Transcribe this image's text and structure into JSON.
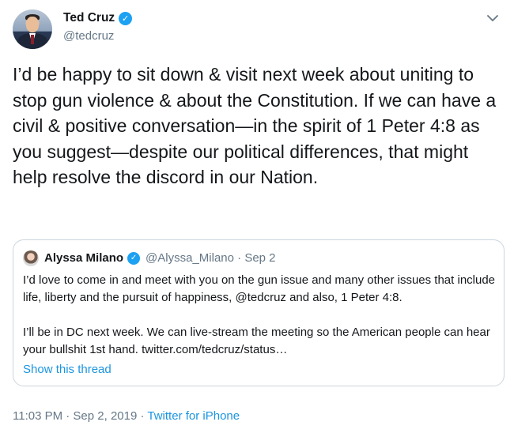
{
  "tweet": {
    "author": {
      "name": "Ted Cruz",
      "handle": "@tedcruz",
      "verified_mark": "✓"
    },
    "text": "I’d be happy to sit down & visit next week about uniting to stop gun violence & about the Constitution. If we can have a civil & positive conversation—in the spirit of 1 Peter 4:8 as you suggest—despite our political differences, that might help resolve the discord in our Nation.",
    "timestamp": "11:03 PM · Sep 2, 2019",
    "source_separator": " · ",
    "source": "Twitter for iPhone"
  },
  "quoted_tweet": {
    "author": {
      "name": "Alyssa Milano",
      "handle_date": "@Alyssa_Milano · Sep 2",
      "verified_mark": "✓"
    },
    "paragraph1": "I’d love to come in and meet with you on the gun issue and many other issues that include life, liberty and the pursuit of happiness, @tedcruz and also, 1 Peter 4:8.",
    "paragraph2": "I’ll be in DC next week. We can live-stream the meeting so the American people can hear your bullshit 1st hand. twitter.com/tedcruz/status…",
    "show_thread": "Show this thread"
  },
  "icons": {
    "verified": "verified-badge-icon",
    "caret": "chevron-down-icon"
  },
  "colors": {
    "text": "#14171a",
    "secondary": "#657786",
    "link": "#1b95e0",
    "verified": "#1da1f2",
    "border": "#ccd6dd"
  }
}
